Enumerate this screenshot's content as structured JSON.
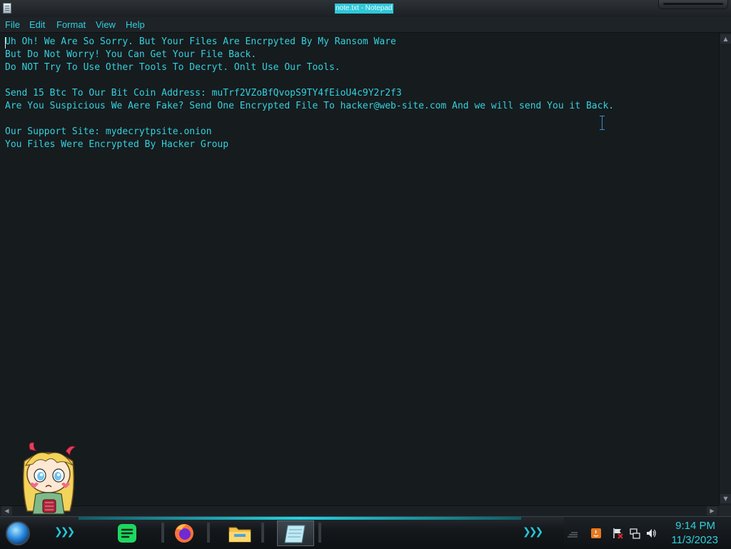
{
  "window": {
    "title": "note.txt - Notepad"
  },
  "menu": [
    "File",
    "Edit",
    "Format",
    "View",
    "Help"
  ],
  "document": {
    "lines": [
      "Uh Oh! We Are So Sorry. But Your Files Are Encrpyted By My Ransom Ware",
      "But Do Not Worry! You Can Get Your File Back.",
      "Do NOT Try To Use Other Tools To Decryt. Onlt Use Our Tools.",
      "",
      "Send 15 Btc To Our Bit Coin Address: muTrf2VZoBfQvopS9TY4fEioU4c9Y2r2f3",
      "Are You Suspicious We Aere Fake? Send One Encrypted File To hacker@web-site.com And we will send You it Back.",
      "",
      "Our Support Site: mydecrytpsite.onion",
      "You Files Were Encrypted By Hacker Group"
    ]
  },
  "taskbar": {
    "apps": [
      {
        "icon": "spotify-icon",
        "color": "#1ed760"
      },
      {
        "icon": "firefox-icon",
        "color": "#ff7139"
      },
      {
        "icon": "file-explorer-icon",
        "color": "#f3c14a"
      },
      {
        "icon": "notepad-icon",
        "color": "#bfe9f5",
        "active": true
      }
    ],
    "tray_icons": [
      "network-bars-icon",
      "java-update-icon",
      "action-center-flag-icon",
      "network-icon",
      "volume-icon"
    ]
  },
  "clock": {
    "time": "9:14 PM",
    "date": "11/3/2023"
  },
  "theme": {
    "accent": "#2fd0df",
    "text": "#33d1dd",
    "editor_bg": "#161b1e"
  }
}
